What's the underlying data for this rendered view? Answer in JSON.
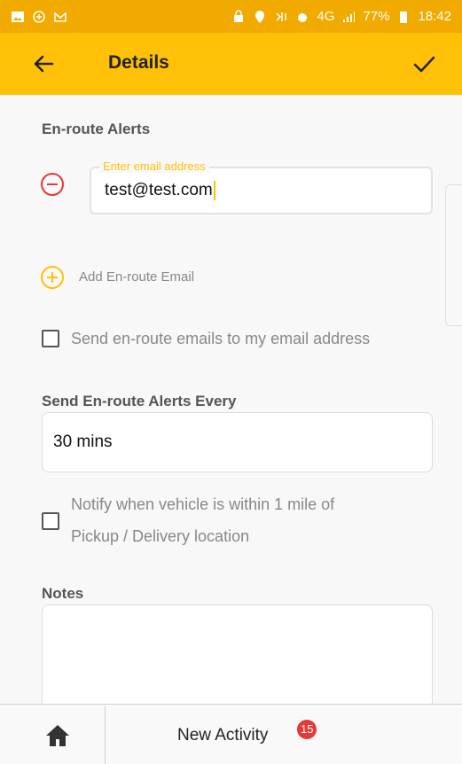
{
  "status_bar": {
    "network": "4G",
    "battery": "77%",
    "time": "18:42"
  },
  "app_bar": {
    "title": "Details"
  },
  "en_route": {
    "section_title": "En-route Alerts",
    "email_label": "Enter email address",
    "email_value": "test@test.com",
    "add_label": "Add En-route Email",
    "self_email_label": "Send en-route emails to my email address",
    "self_email_checked": false
  },
  "frequency": {
    "section_title": "Send En-route Alerts Every",
    "value": "30 mins"
  },
  "proximity": {
    "label_line1": "Notify when vehicle is within 1 mile of",
    "label_line2": "Pickup / Delivery location",
    "checked": false
  },
  "notes": {
    "section_title": "Notes",
    "value": ""
  },
  "bottom_bar": {
    "activity_label": "New Activity",
    "activity_count": "15"
  },
  "colors": {
    "status_bar": "#f1ab00",
    "app_bar": "#ffc107",
    "accent": "#ffc107",
    "remove": "#e53935",
    "badge": "#e53935"
  },
  "icons": [
    "image-icon",
    "location-icon",
    "mail-icon",
    "back-arrow-icon",
    "checkmark-icon",
    "remove-circle-icon",
    "add-circle-icon",
    "home-icon"
  ]
}
